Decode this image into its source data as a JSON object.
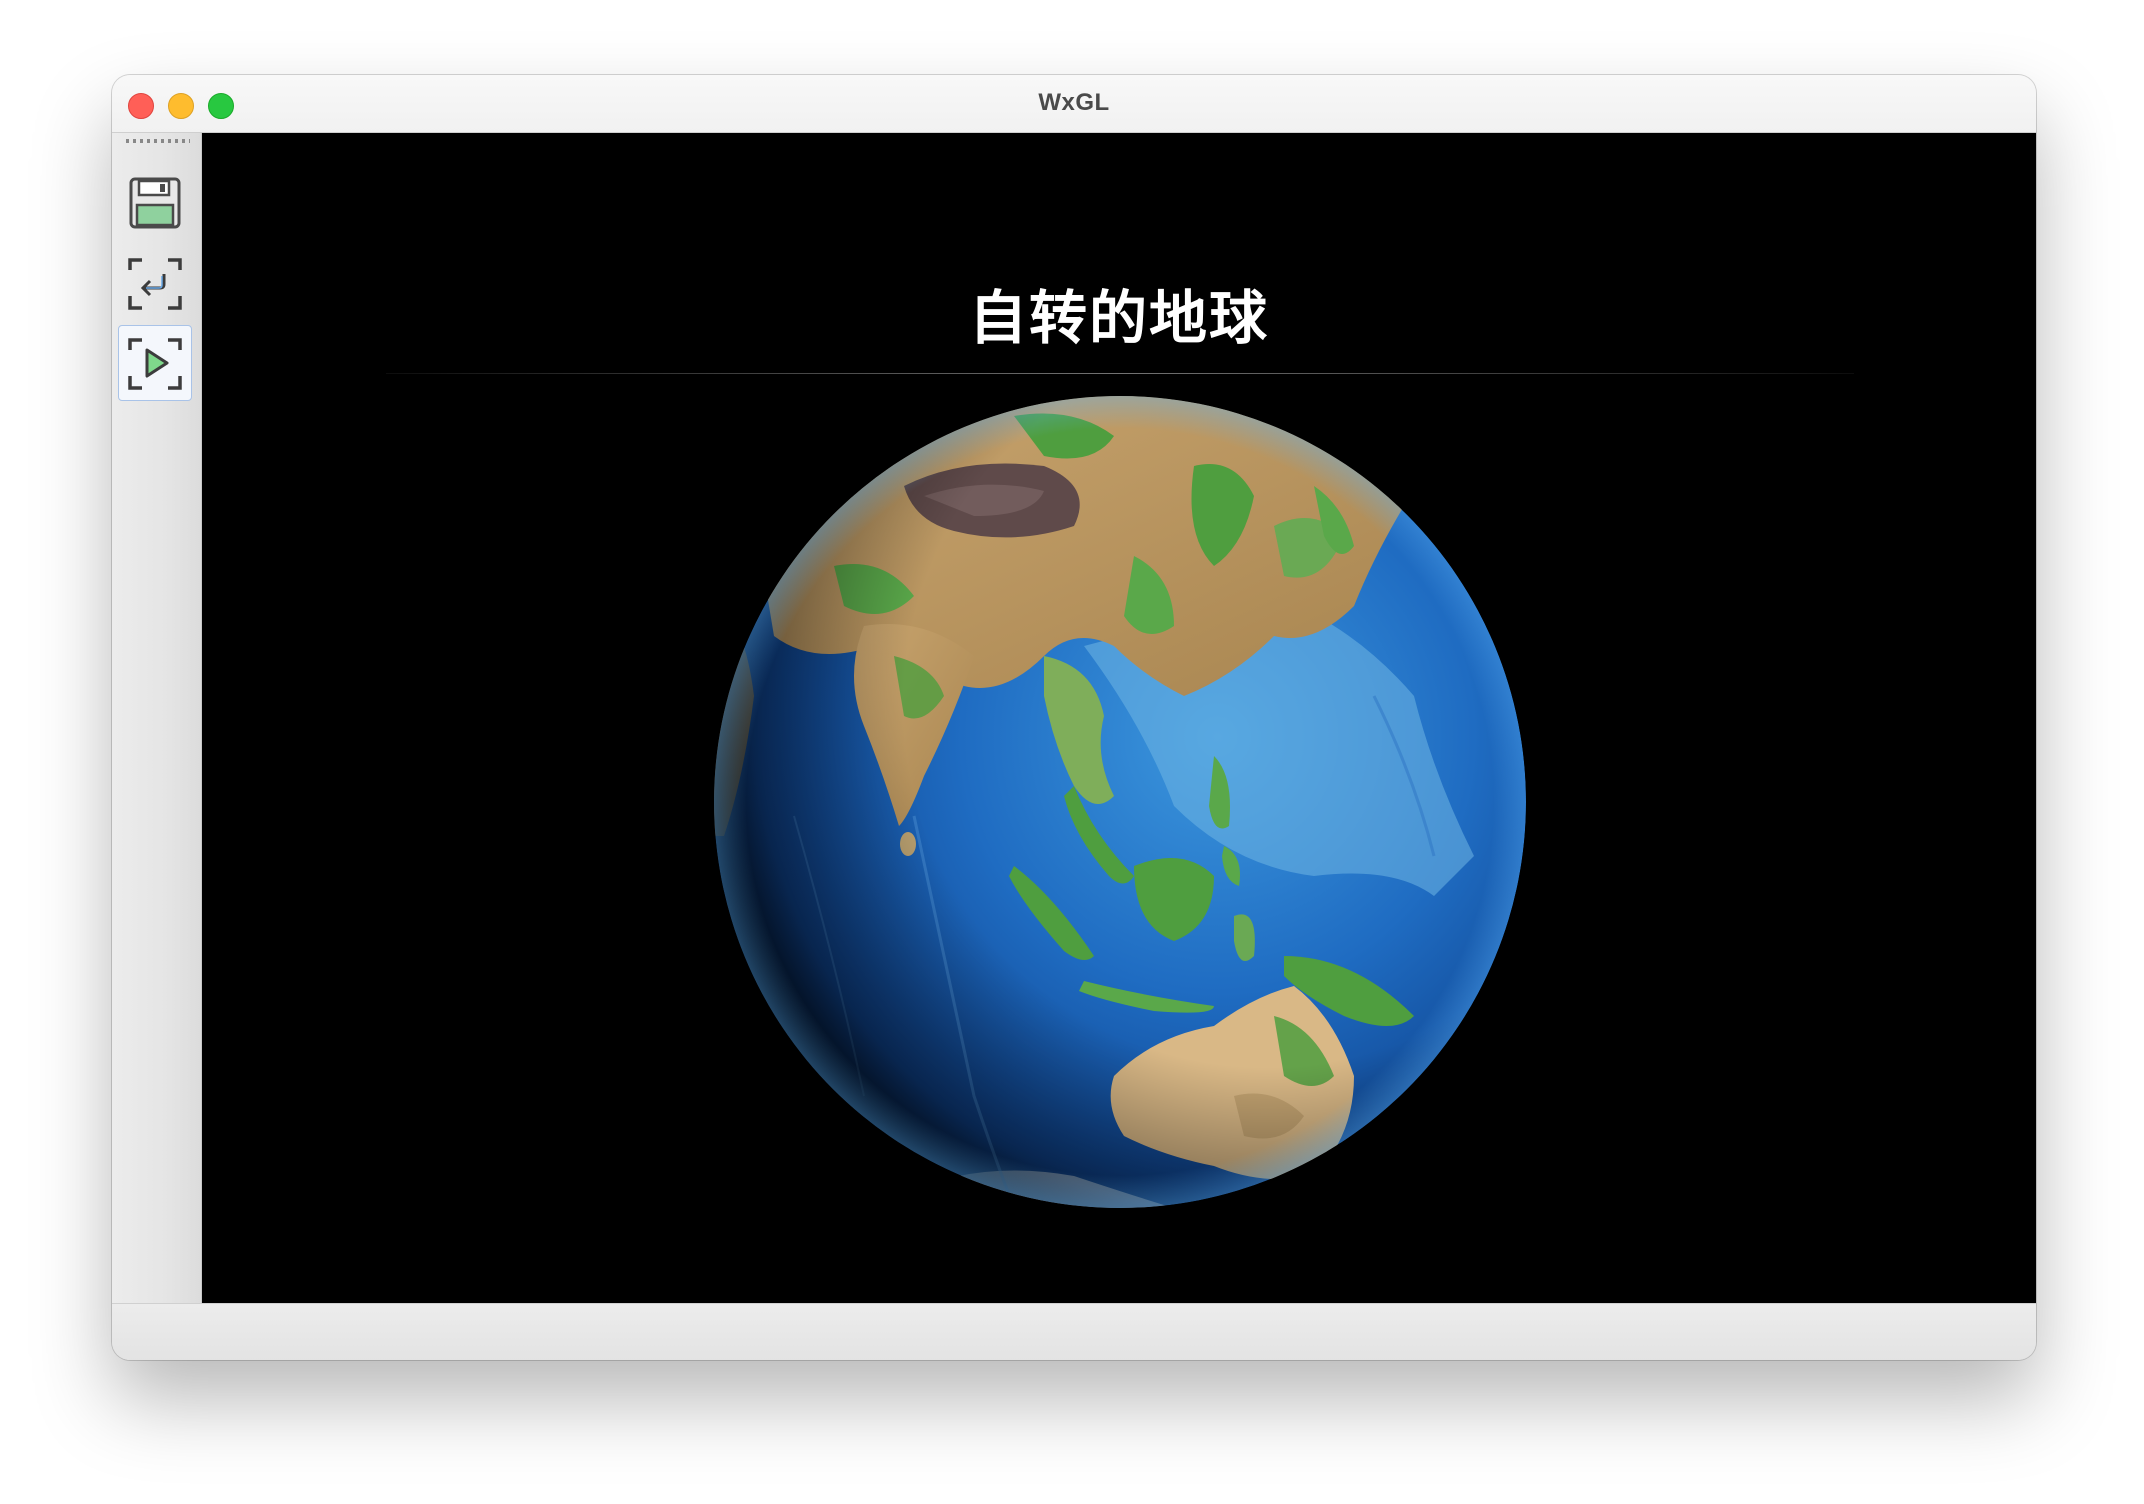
{
  "window": {
    "title": "WxGL"
  },
  "toolbar": {
    "buttons": [
      {
        "name": "save",
        "icon": "floppy-disk-icon",
        "accent": "#8fd19e"
      },
      {
        "name": "reset",
        "icon": "reset-view-icon",
        "accent": "#6aa9e8"
      },
      {
        "name": "play",
        "icon": "play-animation-icon",
        "accent": "#5fc46f",
        "active": true
      }
    ]
  },
  "scene": {
    "heading": "自转的地球",
    "background_color": "#000000",
    "object": "earth-globe"
  },
  "colors": {
    "ocean_deep": "#0b3f8f",
    "ocean_shallow": "#7fc4e8",
    "land_green": "#4f9e3f",
    "land_tan": "#d2b17e",
    "mountain_brown": "#6b5142"
  }
}
